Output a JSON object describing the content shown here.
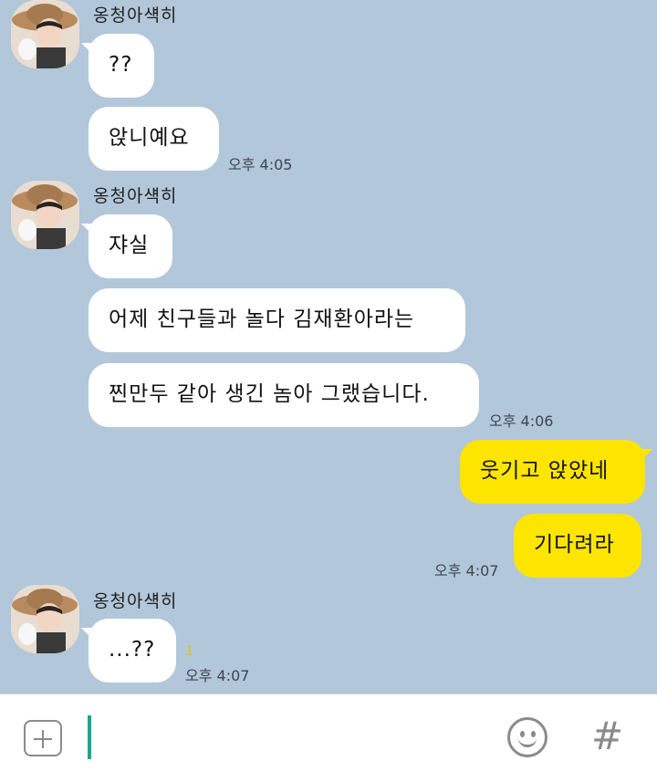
{
  "sender_name": "옹청아섁히",
  "groups": [
    {
      "messages": [
        "??",
        "앉니예요"
      ],
      "time": "오후 4:05"
    },
    {
      "messages": [
        "쟈실",
        "어제 친구들과 놀다 김재환아라는",
        "찐만두 같아 생긴 놈아 그랬습니다."
      ],
      "time": "오후 4:06"
    },
    {
      "mine": true,
      "messages": [
        "웃기고 앉았네",
        "기다려라"
      ],
      "time": "오후 4:07"
    },
    {
      "messages": [
        "...??"
      ],
      "unread": "1",
      "time": "오후 4:07"
    }
  ],
  "input": {
    "value": ""
  }
}
